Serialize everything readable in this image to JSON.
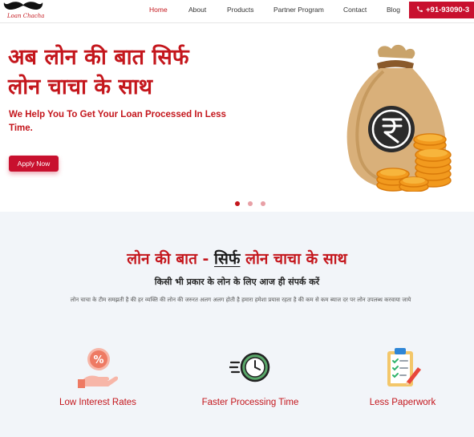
{
  "brand": {
    "logo_text": "Loan Chacha",
    "accent": "#c4161c",
    "button": "#c8102e"
  },
  "nav": {
    "items": [
      {
        "label": "Home",
        "active": true
      },
      {
        "label": "About",
        "active": false
      },
      {
        "label": "Products",
        "active": false
      },
      {
        "label": "Partner Program",
        "active": false
      },
      {
        "label": "Contact",
        "active": false
      },
      {
        "label": "Blog",
        "active": false
      }
    ],
    "phone": "+91-93090-3",
    "phone_icon": "phone-icon"
  },
  "hero": {
    "title_line1": "अब लोन की बात सिर्फ",
    "title_line2": "लोन चाचा के साथ",
    "subtitle": "We Help You To Get Your Loan Processed In Less Time.",
    "cta": "Apply Now",
    "image_icon": "money-bag-rupee-icon",
    "slides": 3,
    "active_slide": 1
  },
  "features_section": {
    "title_part1": "लोन की बात - ",
    "title_highlight": "सिर्फ",
    "title_part2": " लोन चाचा के साथ",
    "subtitle": "किसी भी प्रकार के लोन के लिए आज ही संपर्क करें",
    "description": "लोन चाचा के टीम समझती है की हर व्यक्ति की लोन की जरुरत अलग अलग होती है हमारा हमेशा प्रयास रहता है की कम से कम ब्याज दर  पर लोन उपलब्ध करवाया जाये",
    "features": [
      {
        "label": "Low Interest Rates",
        "icon": "percent-hand-icon"
      },
      {
        "label": "Faster Processing Time",
        "icon": "fast-clock-icon"
      },
      {
        "label": "Less Paperwork",
        "icon": "checklist-clipboard-icon"
      }
    ]
  }
}
